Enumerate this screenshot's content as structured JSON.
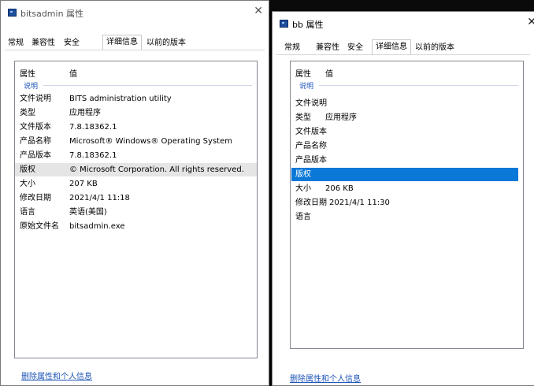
{
  "colors": {
    "selection_blue": "#0a78d7",
    "hover_grey": "#e5e5e5",
    "link_blue": "#1f55b8",
    "group_blue": "#1f55b8"
  },
  "tabs": [
    "常规",
    "兼容性",
    "安全",
    "详细信息",
    "以前的版本"
  ],
  "column_headers": {
    "property": "属性",
    "value": "值"
  },
  "group_label": "说明",
  "bottom_link": "删除属性和个人信息",
  "close_icon": "✕",
  "window_a": {
    "title": "bitsadmin 属性",
    "rows": [
      {
        "key": "文件说明",
        "value": "BITS administration utility"
      },
      {
        "key": "类型",
        "value": "应用程序"
      },
      {
        "key": "文件版本",
        "value": "7.8.18362.1"
      },
      {
        "key": "产品名称",
        "value": "Microsoft® Windows® Operating System"
      },
      {
        "key": "产品版本",
        "value": "7.8.18362.1"
      },
      {
        "key": "版权",
        "value": "© Microsoft Corporation. All rights reserved."
      },
      {
        "key": "大小",
        "value": "207 KB"
      },
      {
        "key": "修改日期",
        "value": "2021/4/1 11:18"
      },
      {
        "key": "语言",
        "value": "英语(美国)"
      },
      {
        "key": "原始文件名",
        "value": "bitsadmin.exe"
      }
    ]
  },
  "window_b": {
    "title": "bb 属性",
    "rows": [
      {
        "key": "文件说明",
        "value": ""
      },
      {
        "key": "类型",
        "value": "应用程序"
      },
      {
        "key": "文件版本",
        "value": ""
      },
      {
        "key": "产品名称",
        "value": ""
      },
      {
        "key": "产品版本",
        "value": ""
      },
      {
        "key": "版权",
        "value": ""
      },
      {
        "key": "大小",
        "value": "206 KB"
      },
      {
        "key": "修改日期",
        "value": "2021/4/1 11:30"
      },
      {
        "key": "语言",
        "value": ""
      }
    ]
  }
}
